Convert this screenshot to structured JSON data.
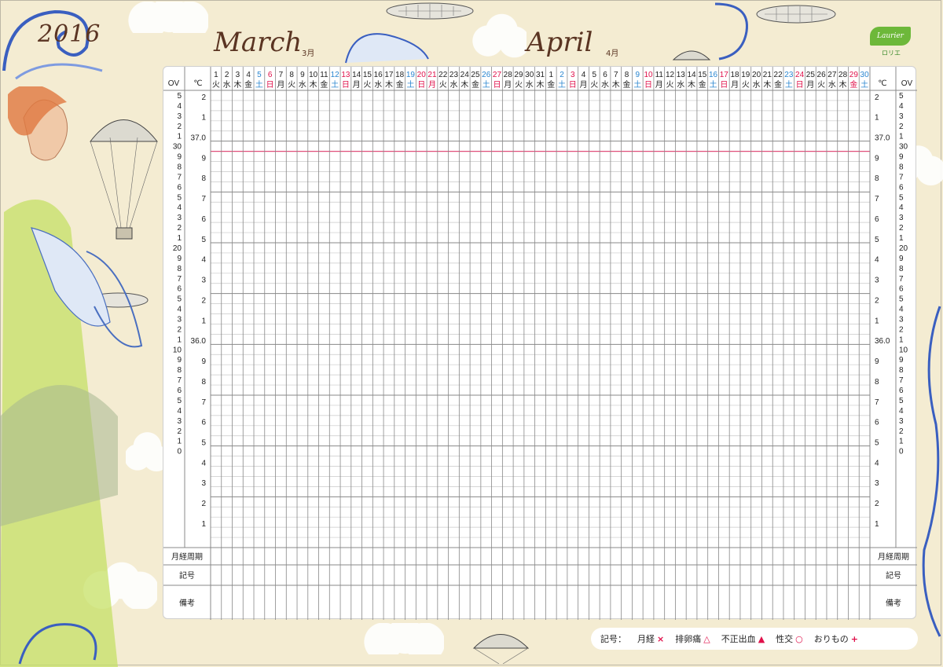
{
  "year": "2016",
  "months": [
    {
      "name": "March",
      "sub": "3月"
    },
    {
      "name": "April",
      "sub": "4月"
    }
  ],
  "logo": {
    "text": "Laurier",
    "sub": "ロリエ"
  },
  "columns": {
    "ov": "OV",
    "celsius": "℃"
  },
  "days": [
    {
      "d": "1",
      "w": "火",
      "c": "k"
    },
    {
      "d": "2",
      "w": "水",
      "c": "k"
    },
    {
      "d": "3",
      "w": "木",
      "c": "k"
    },
    {
      "d": "4",
      "w": "金",
      "c": "k"
    },
    {
      "d": "5",
      "w": "土",
      "c": "b"
    },
    {
      "d": "6",
      "w": "日",
      "c": "r"
    },
    {
      "d": "7",
      "w": "月",
      "c": "k"
    },
    {
      "d": "8",
      "w": "火",
      "c": "k"
    },
    {
      "d": "9",
      "w": "水",
      "c": "k"
    },
    {
      "d": "10",
      "w": "木",
      "c": "k"
    },
    {
      "d": "11",
      "w": "金",
      "c": "k"
    },
    {
      "d": "12",
      "w": "土",
      "c": "b"
    },
    {
      "d": "13",
      "w": "日",
      "c": "r"
    },
    {
      "d": "14",
      "w": "月",
      "c": "k"
    },
    {
      "d": "15",
      "w": "火",
      "c": "k"
    },
    {
      "d": "16",
      "w": "水",
      "c": "k"
    },
    {
      "d": "17",
      "w": "木",
      "c": "k"
    },
    {
      "d": "18",
      "w": "金",
      "c": "k"
    },
    {
      "d": "19",
      "w": "土",
      "c": "b"
    },
    {
      "d": "20",
      "w": "日",
      "c": "r"
    },
    {
      "d": "21",
      "w": "月",
      "c": "r"
    },
    {
      "d": "22",
      "w": "火",
      "c": "k"
    },
    {
      "d": "23",
      "w": "水",
      "c": "k"
    },
    {
      "d": "24",
      "w": "木",
      "c": "k"
    },
    {
      "d": "25",
      "w": "金",
      "c": "k"
    },
    {
      "d": "26",
      "w": "土",
      "c": "b"
    },
    {
      "d": "27",
      "w": "日",
      "c": "r"
    },
    {
      "d": "28",
      "w": "月",
      "c": "k"
    },
    {
      "d": "29",
      "w": "火",
      "c": "k"
    },
    {
      "d": "30",
      "w": "水",
      "c": "k"
    },
    {
      "d": "31",
      "w": "木",
      "c": "k"
    },
    {
      "d": "1",
      "w": "金",
      "c": "k"
    },
    {
      "d": "2",
      "w": "土",
      "c": "b"
    },
    {
      "d": "3",
      "w": "日",
      "c": "r"
    },
    {
      "d": "4",
      "w": "月",
      "c": "k"
    },
    {
      "d": "5",
      "w": "火",
      "c": "k"
    },
    {
      "d": "6",
      "w": "水",
      "c": "k"
    },
    {
      "d": "7",
      "w": "木",
      "c": "k"
    },
    {
      "d": "8",
      "w": "金",
      "c": "k"
    },
    {
      "d": "9",
      "w": "土",
      "c": "b"
    },
    {
      "d": "10",
      "w": "日",
      "c": "r"
    },
    {
      "d": "11",
      "w": "月",
      "c": "k"
    },
    {
      "d": "12",
      "w": "火",
      "c": "k"
    },
    {
      "d": "13",
      "w": "水",
      "c": "k"
    },
    {
      "d": "14",
      "w": "木",
      "c": "k"
    },
    {
      "d": "15",
      "w": "金",
      "c": "k"
    },
    {
      "d": "16",
      "w": "土",
      "c": "b"
    },
    {
      "d": "17",
      "w": "日",
      "c": "r"
    },
    {
      "d": "18",
      "w": "月",
      "c": "k"
    },
    {
      "d": "19",
      "w": "火",
      "c": "k"
    },
    {
      "d": "20",
      "w": "水",
      "c": "k"
    },
    {
      "d": "21",
      "w": "木",
      "c": "k"
    },
    {
      "d": "22",
      "w": "金",
      "c": "k"
    },
    {
      "d": "23",
      "w": "土",
      "c": "b"
    },
    {
      "d": "24",
      "w": "日",
      "c": "r"
    },
    {
      "d": "25",
      "w": "月",
      "c": "k"
    },
    {
      "d": "26",
      "w": "火",
      "c": "k"
    },
    {
      "d": "27",
      "w": "水",
      "c": "k"
    },
    {
      "d": "28",
      "w": "木",
      "c": "k"
    },
    {
      "d": "29",
      "w": "金",
      "c": "r"
    },
    {
      "d": "30",
      "w": "土",
      "c": "b"
    }
  ],
  "ov_labels": [
    "5",
    "4",
    "3",
    "2",
    "1",
    "30",
    "9",
    "8",
    "7",
    "6",
    "5",
    "4",
    "3",
    "2",
    "1",
    "20",
    "9",
    "8",
    "7",
    "6",
    "5",
    "4",
    "3",
    "2",
    "1",
    "10",
    "9",
    "8",
    "7",
    "6",
    "5",
    "4",
    "3",
    "2",
    "1",
    "0"
  ],
  "temp_labels": [
    "2",
    "1",
    "37.0",
    "9",
    "8",
    "7",
    "6",
    "5",
    "4",
    "3",
    "2",
    "1",
    "36.0",
    "9",
    "8",
    "7",
    "6",
    "5",
    "4",
    "3",
    "2",
    "1"
  ],
  "row_labels": [
    "月経周期",
    "記号",
    "備考"
  ],
  "legend": {
    "title": "記号：",
    "items": [
      {
        "label": "月経",
        "mark": "×"
      },
      {
        "label": "排卵痛",
        "mark": "△"
      },
      {
        "label": "不正出血",
        "mark": "▲"
      },
      {
        "label": "性交",
        "mark": "○"
      },
      {
        "label": "おりもの",
        "mark": "+"
      }
    ]
  },
  "colors": {
    "red": "#e0104a",
    "blue": "#2a86d0",
    "black": "#222222",
    "grid": "#888888",
    "grid_light": "#c8c8c8",
    "ref_line": "#e0507a"
  }
}
